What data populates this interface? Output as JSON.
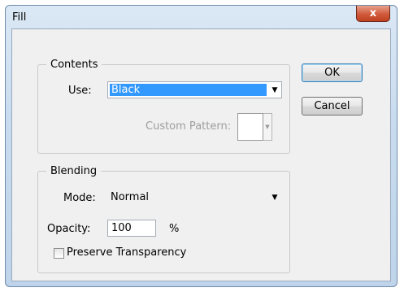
{
  "window": {
    "title": "Fill",
    "close_glyph": "x"
  },
  "contents": {
    "label": "Contents",
    "use_label": "Use:",
    "use_value": "Black",
    "custom_pattern_label": "Custom Pattern:"
  },
  "blending": {
    "label": "Blending",
    "mode_label": "Mode:",
    "mode_value": "Normal",
    "opacity_label": "Opacity:",
    "opacity_value": "100",
    "opacity_unit": "%",
    "preserve_label": "Preserve Transparency"
  },
  "buttons": {
    "ok": "OK",
    "cancel": "Cancel"
  },
  "icons": {
    "dropdown": "chevron-down-icon",
    "close": "close-icon"
  }
}
